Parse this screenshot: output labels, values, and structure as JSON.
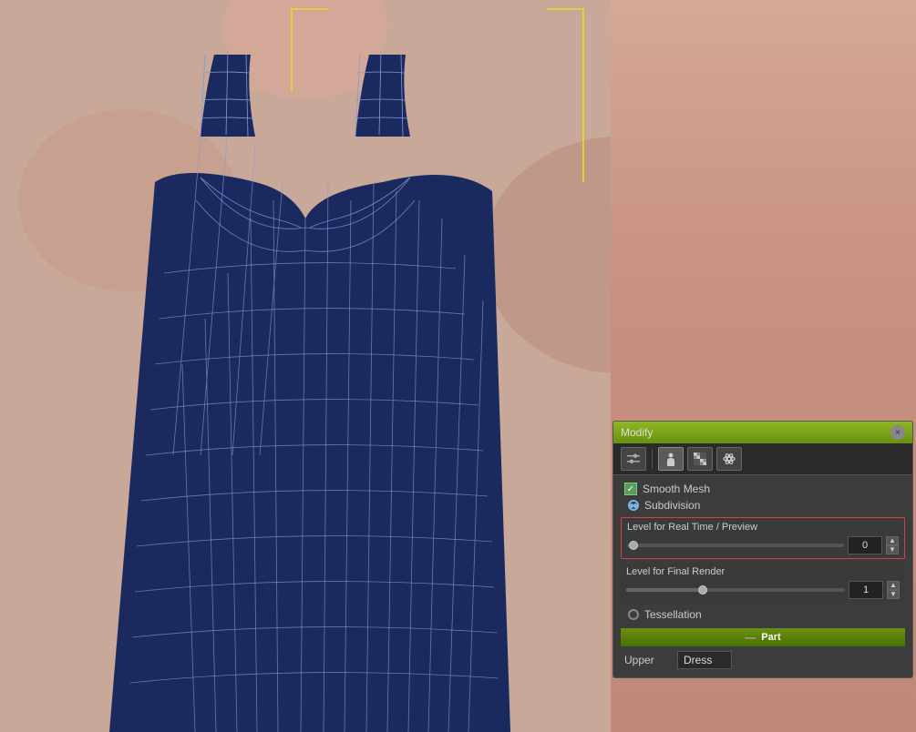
{
  "viewport": {
    "background": "#c8a090"
  },
  "panel": {
    "title": "Modify",
    "close_label": "×",
    "toolbar": {
      "btn1_icon": "⚙",
      "btn2_icon": "⚙",
      "btn3_icon": "✦"
    },
    "smooth_mesh": {
      "label": "Smooth Mesh",
      "checked": true
    },
    "subdivision": {
      "label": "Subdivision",
      "selected": true
    },
    "level_realtime": {
      "label": "Level for Real Time / Preview",
      "value": "0",
      "slider_pct": 0
    },
    "level_final": {
      "label": "Level for Final Render",
      "value": "1",
      "slider_pct": 33
    },
    "tessellation": {
      "label": "Tessellation"
    },
    "part_section": {
      "label": "Part"
    },
    "upper_label": "Upper",
    "upper_value": "Dress"
  }
}
